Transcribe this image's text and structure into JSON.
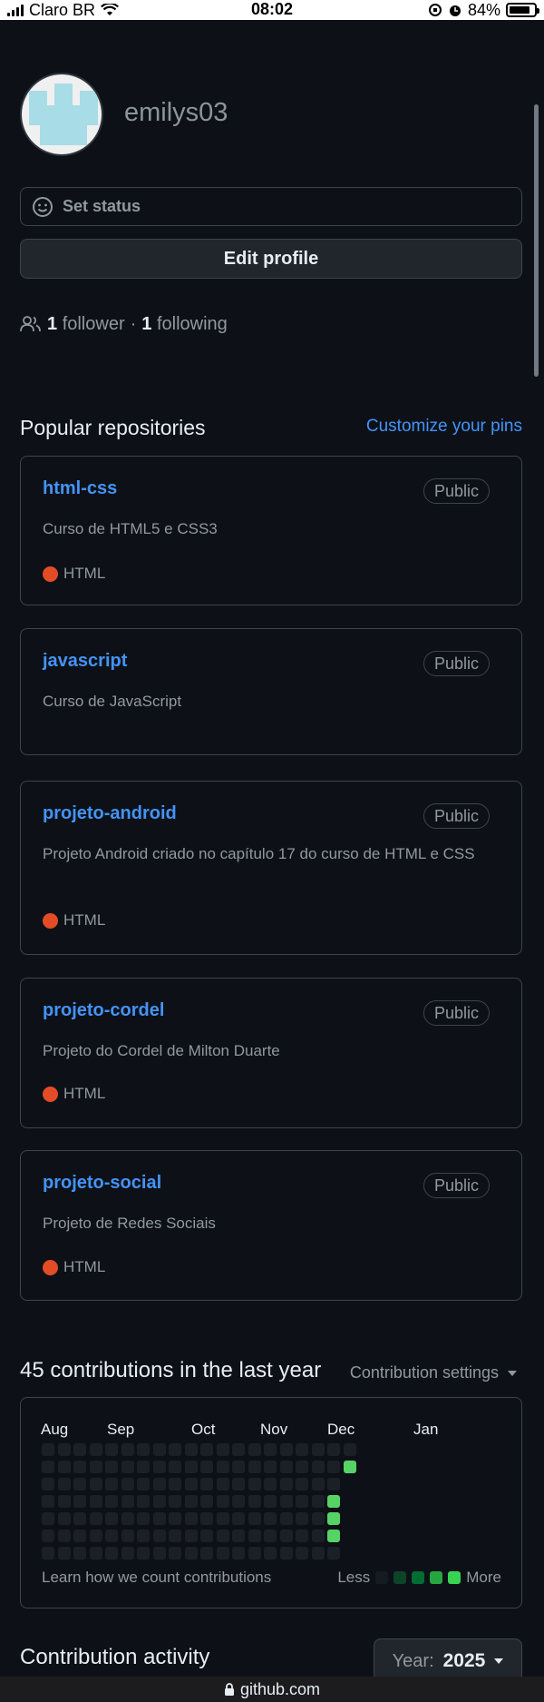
{
  "status_bar": {
    "carrier": "Claro BR",
    "time": "08:02",
    "battery_percent": "84%",
    "battery_level": 0.84
  },
  "profile": {
    "username": "emilys03",
    "set_status_label": "Set status",
    "edit_profile_label": "Edit profile",
    "followers_count": "1",
    "followers_label": "follower",
    "separator": "·",
    "following_count": "1",
    "following_label": "following"
  },
  "popular": {
    "title": "Popular repositories",
    "customize_label": "Customize your pins",
    "repos": [
      {
        "name": "html-css",
        "visibility": "Public",
        "description": "Curso de HTML5 e CSS3",
        "language": "HTML",
        "language_color": "#e34c26"
      },
      {
        "name": "javascript",
        "visibility": "Public",
        "description": "Curso de JavaScript",
        "language": "",
        "language_color": ""
      },
      {
        "name": "projeto-android",
        "visibility": "Public",
        "description": "Projeto Android criado no capítulo 17 do curso de HTML e CSS",
        "language": "HTML",
        "language_color": "#e34c26"
      },
      {
        "name": "projeto-cordel",
        "visibility": "Public",
        "description": "Projeto do Cordel de Milton Duarte",
        "language": "HTML",
        "language_color": "#e34c26"
      },
      {
        "name": "projeto-social",
        "visibility": "Public",
        "description": "Projeto de Redes Sociais",
        "language": "HTML",
        "language_color": "#e34c26"
      }
    ]
  },
  "contributions": {
    "title": "45 contributions in the last year",
    "settings_label": "Contribution settings",
    "months": [
      "Aug",
      "Sep",
      "Oct",
      "Nov",
      "Dec",
      "Jan"
    ],
    "learn_label": "Learn how we count contributions",
    "legend_less": "Less",
    "legend_more": "More",
    "level_colors": [
      "#161b22",
      "#0e4429",
      "#006d32",
      "#26a641",
      "#39d353"
    ],
    "active_cells": [
      {
        "week": 18,
        "day": 0,
        "level": 0
      },
      {
        "week": 18,
        "day": 3,
        "level": 3
      },
      {
        "week": 18,
        "day": 4,
        "level": 3
      },
      {
        "week": 18,
        "day": 5,
        "level": 3
      },
      {
        "week": 19,
        "day": 1,
        "level": 3
      },
      {
        "week": 19,
        "day": 2,
        "level": 3
      },
      {
        "week": 19,
        "day": 3,
        "level": 3
      },
      {
        "week": 19,
        "day": 4,
        "level": 3
      }
    ],
    "weeks": 20,
    "days": 7
  },
  "activity": {
    "title": "Contribution activity",
    "year_prefix": "Year:",
    "year_value": "2025"
  },
  "url_bar": {
    "domain": "github.com"
  },
  "colors": {
    "background": "#0d1117",
    "link": "#4493f8",
    "border": "#3d444d",
    "muted": "#9198a1"
  }
}
